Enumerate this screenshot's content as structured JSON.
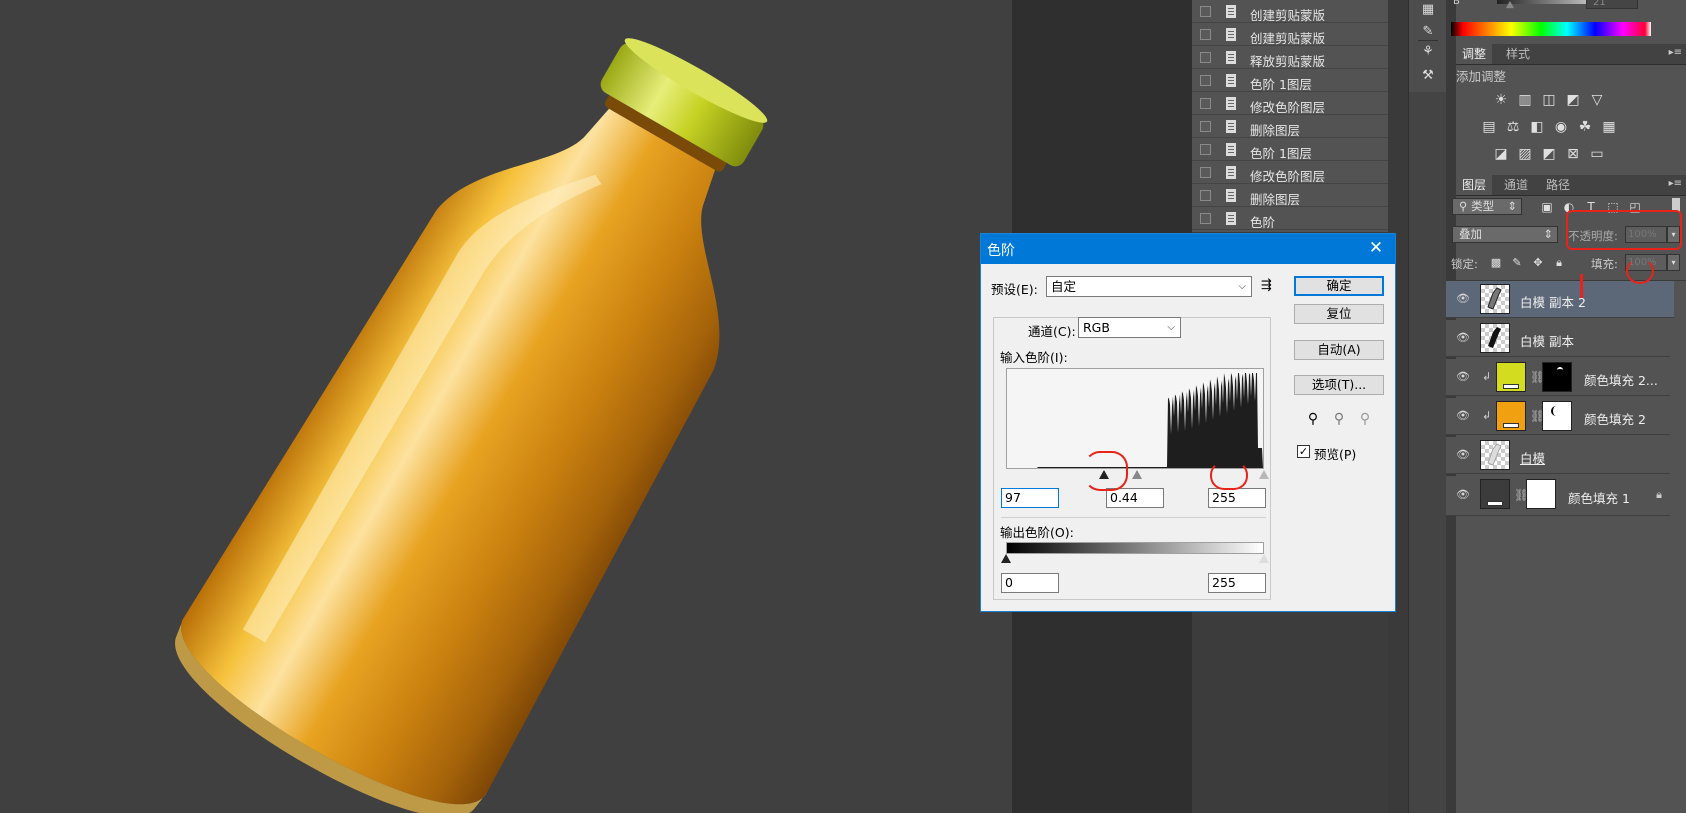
{
  "history": {
    "items": [
      {
        "label": "创建剪贴蒙版"
      },
      {
        "label": "创建剪贴蒙版"
      },
      {
        "label": "释放剪贴蒙版"
      },
      {
        "label": "色阶 1图层"
      },
      {
        "label": "修改色阶图层"
      },
      {
        "label": "删除图层"
      },
      {
        "label": "色阶 1图层"
      },
      {
        "label": "修改色阶图层"
      },
      {
        "label": "删除图层"
      },
      {
        "label": "色阶"
      }
    ]
  },
  "color_panel": {
    "value_label": "21"
  },
  "adjustments": {
    "tabs": [
      "调整",
      "样式"
    ],
    "title": "添加调整"
  },
  "layers_panel": {
    "tabs": [
      "图层",
      "通道",
      "路径"
    ],
    "filter_kind": "类型",
    "blend_mode": "叠加",
    "opacity_label": "不透明度:",
    "opacity_value": "100%",
    "lock_label": "锁定:",
    "fill_label": "填充:",
    "fill_value": "100%",
    "layers": [
      {
        "name": "白模 副本 2"
      },
      {
        "name": "白模 副本"
      },
      {
        "name": "颜色填充 2..."
      },
      {
        "name": "颜色填充 2"
      },
      {
        "name": "白模"
      },
      {
        "name": "颜色填充 1"
      }
    ],
    "colors": {
      "fill_yellow": "#d4dc1f",
      "fill_orange": "#f1a10f",
      "fill_dark": "#3c3c3c"
    }
  },
  "levels_dialog": {
    "title": "色阶",
    "preset_label": "预设(E):",
    "preset_value": "自定",
    "channel_label": "通道(C):",
    "channel_value": "RGB",
    "input_label": "输入色阶(I):",
    "input_black": "97",
    "input_gamma": "0.44",
    "input_white": "255",
    "input_black_level": 97,
    "input_gamma_level": 0.44,
    "input_white_level": 255,
    "output_label": "输出色阶(O):",
    "output_black": "0",
    "output_white": "255",
    "buttons": {
      "ok": "确定",
      "reset": "复位",
      "auto": "自动(A)",
      "options": "选项(T)..."
    },
    "preview_label": "预览(P)",
    "preview_checked": true
  }
}
